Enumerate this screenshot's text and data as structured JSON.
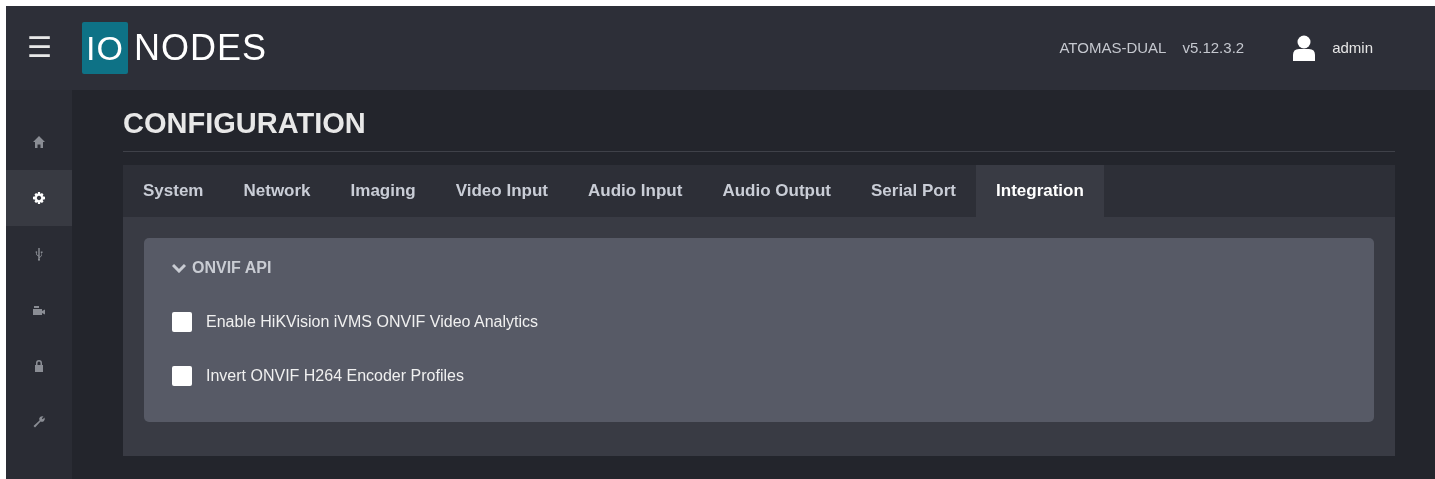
{
  "header": {
    "menu": "☰",
    "logo_box": "IO",
    "logo_text": "NODES",
    "device": "ATOMAS-DUAL",
    "version": "v5.12.3.2",
    "user": "admin"
  },
  "sidebar": {
    "items": [
      {
        "kind": "home",
        "selected": false
      },
      {
        "kind": "gear",
        "selected": true
      },
      {
        "kind": "usb",
        "selected": false
      },
      {
        "kind": "camera",
        "selected": false
      },
      {
        "kind": "lock",
        "selected": false
      },
      {
        "kind": "wrench",
        "selected": false
      }
    ]
  },
  "page_title": "CONFIGURATION",
  "tabs": [
    {
      "label": "System",
      "selected": false
    },
    {
      "label": "Network",
      "selected": false
    },
    {
      "label": "Imaging",
      "selected": false
    },
    {
      "label": "Video Input",
      "selected": false
    },
    {
      "label": "Audio Input",
      "selected": false
    },
    {
      "label": "Audio Output",
      "selected": false
    },
    {
      "label": "Serial Port",
      "selected": false
    },
    {
      "label": "Integration",
      "selected": true
    }
  ],
  "section": {
    "title": "ONVIF API",
    "expanded": true,
    "options": [
      {
        "label": "Enable HiKVision iVMS ONVIF Video Analytics",
        "checked": false
      },
      {
        "label": "Invert ONVIF H264 Encoder Profiles",
        "checked": false
      }
    ]
  }
}
